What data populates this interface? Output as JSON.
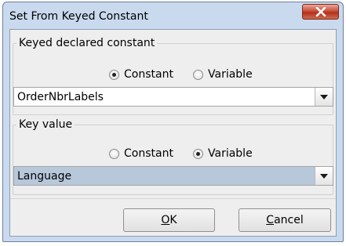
{
  "window": {
    "title": "Set From Keyed Constant"
  },
  "keyed_group": {
    "legend": "Keyed declared constant",
    "radio_constant": "Constant",
    "radio_variable": "Variable",
    "selected": "Constant",
    "combo_value": "OrderNbrLabels"
  },
  "key_group": {
    "legend": "Key value",
    "radio_constant": "Constant",
    "radio_variable": "Variable",
    "selected": "Variable",
    "combo_value": "Language"
  },
  "buttons": {
    "ok_mnemonic": "O",
    "ok_rest": "K",
    "cancel_mnemonic": "C",
    "cancel_rest": "ancel"
  },
  "icons": {
    "close": "close-x-icon",
    "dropdown": "triangle-down-icon"
  },
  "colors": {
    "frame": "#c9d9ee",
    "close_button": "#c9503a",
    "combo_selected_bg": "#b8c8db"
  }
}
